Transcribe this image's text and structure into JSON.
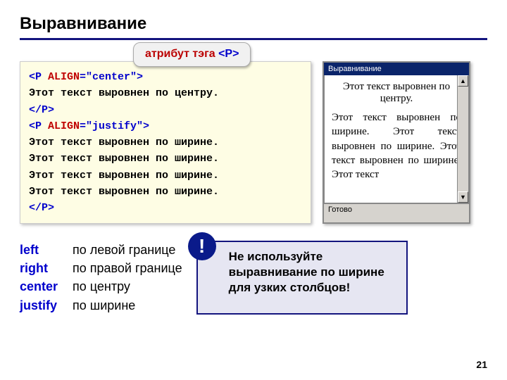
{
  "title": "Выравнивание",
  "tag_label_prefix": "атрибут тэга ",
  "tag_label_tag": "<P>",
  "code": {
    "l1a": "<P ",
    "l1b": "ALIGN",
    "l1c": "=\"center\">",
    "l2": "Этот текст выровнен по центру.",
    "l3": "</P>",
    "l4a": "<P ",
    "l4b": "ALIGN",
    "l4c": "=\"justify\">",
    "l5": "Этот текст выровнен по ширине.",
    "l6": "Этот текст выровнен по ширине.",
    "l7": "Этот текст выровнен по ширине.",
    "l8": "Этот текст выровнен по ширине.",
    "l9": "</P>"
  },
  "browser": {
    "title": "Выравнивание",
    "center_text": "Этот текст выровнен по центру.",
    "justify_text": "Этот текст выровнен по ширине. Этот текст выровнен по ширине. Этот текст выровнен по ширине. Этот текст",
    "status": "Готово",
    "up": "▲",
    "down": "▼"
  },
  "defs": [
    {
      "kw": "left",
      "desc": "по левой границе"
    },
    {
      "kw": "right",
      "desc": "по правой границе"
    },
    {
      "kw": "center",
      "desc": "по центру"
    },
    {
      "kw": "justify",
      "desc": "по ширине"
    }
  ],
  "warn_icon": "!",
  "warn_text": "Не используйте выравнивание по ширине для узких столбцов!",
  "page_number": "21"
}
